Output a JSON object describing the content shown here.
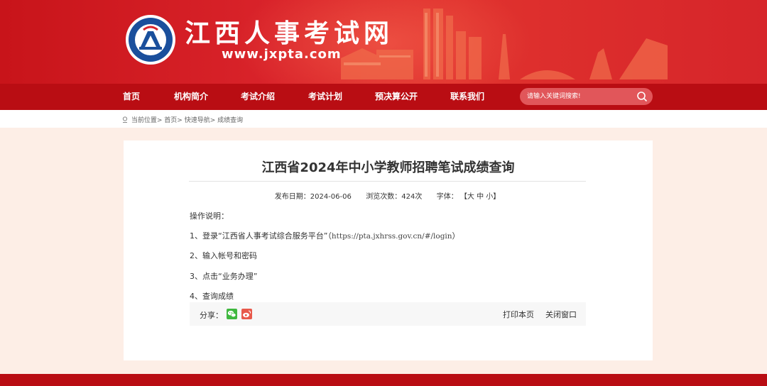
{
  "header": {
    "site_title": "江西人事考试网",
    "site_url": "www.jxpta.com",
    "logo_icon": "jxpta-emblem-icon",
    "colors": {
      "banner": "#d9232a",
      "nav": "#b90d13"
    }
  },
  "nav": {
    "items": [
      "首页",
      "机构简介",
      "考试介绍",
      "考试计划",
      "预决算公开",
      "联系我们"
    ]
  },
  "search": {
    "placeholder": "请输入关键词搜索!",
    "icon": "search-icon"
  },
  "breadcrumb": {
    "prefix": "当前位置>",
    "items": [
      "首页>",
      "快速导航>",
      "成绩查询"
    ]
  },
  "article": {
    "title": "江西省2024年中小学教师招聘笔试成绩查询",
    "publish_label": "发布日期：",
    "publish_date": "2024-06-06",
    "views_label": "浏览次数：",
    "views": "424次",
    "font_label": "字体：",
    "font_options": "【大 中 小】",
    "paragraphs": [
      "操作说明：",
      "1、登录“江西省人事考试综合服务平台”（",
      "2、输入帐号和密码",
      "3、点击“业务办理”",
      "4、查询成绩"
    ],
    "login_url": "https://pta.jxhrss.gov.cn/#/login",
    "url_close": "）"
  },
  "share": {
    "label": "分享：",
    "icons": [
      "wechat-icon",
      "weibo-icon"
    ],
    "print_label": "打印本页",
    "close_label": "关闭窗口"
  }
}
